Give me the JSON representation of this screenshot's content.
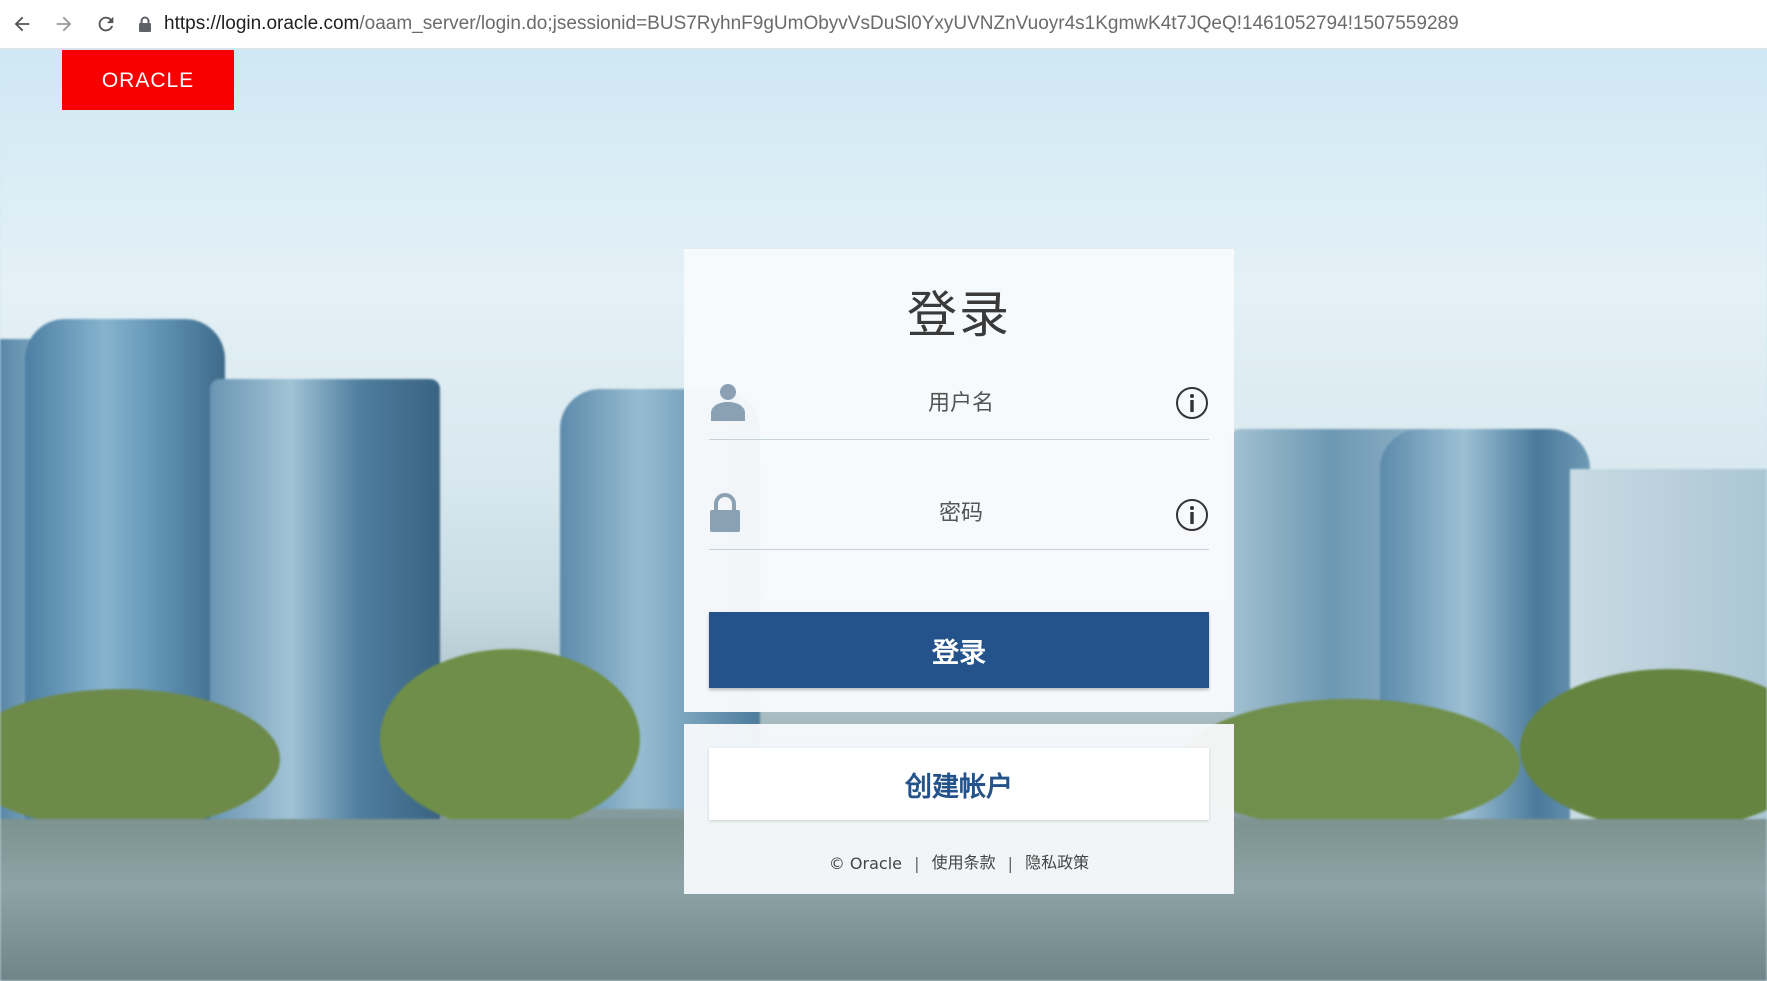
{
  "browser": {
    "url_host": "https://login.oracle.com",
    "url_path": "/oaam_server/login.do;jsessionid=BUS7RyhnF9gUmObyvVsDuSl0YxyUVNZnVuoyr4s1KgmwK4t7JQeQ!1461052794!1507559289",
    "icons": [
      "back-arrow-icon",
      "forward-arrow-icon",
      "reload-icon",
      "lock-icon"
    ]
  },
  "brand": {
    "logo_text": "ORACLE",
    "logo_color": "#f80000"
  },
  "login": {
    "title": "登录",
    "username_placeholder": "用户名",
    "password_placeholder": "密码",
    "username_icon": "user-icon",
    "password_icon": "lock-icon",
    "info_icon": "info-icon",
    "submit_label": "登录"
  },
  "account": {
    "create_label": "创建帐户",
    "footer": {
      "copyright": "© Oracle",
      "terms": "使用条款",
      "privacy": "隐私政策",
      "separator": "|"
    }
  },
  "colors": {
    "primary": "#23538a",
    "brand_red": "#f80000"
  }
}
